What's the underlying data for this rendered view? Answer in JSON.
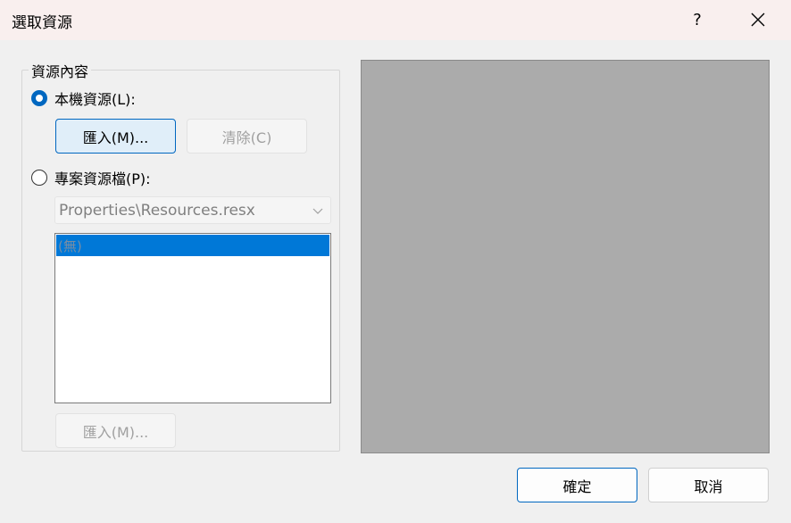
{
  "window": {
    "title": "選取資源",
    "help_label": "?"
  },
  "group": {
    "label": "資源內容",
    "local_radio_label": "本機資源(L):",
    "local_radio_checked": true,
    "import_local_label": "匯入(M)...",
    "clear_label": "清除(C)",
    "project_radio_label": "專案資源檔(P):",
    "project_radio_checked": false,
    "resource_file_selected": "Properties\\Resources.resx",
    "list_items": [
      "(無)"
    ],
    "import_project_label": "匯入(M)..."
  },
  "footer": {
    "ok_label": "確定",
    "cancel_label": "取消"
  },
  "colors": {
    "accent": "#0067c0",
    "selection": "#0078d7",
    "preview_bg": "#ababab",
    "titlebar_bg": "#f9efee"
  }
}
